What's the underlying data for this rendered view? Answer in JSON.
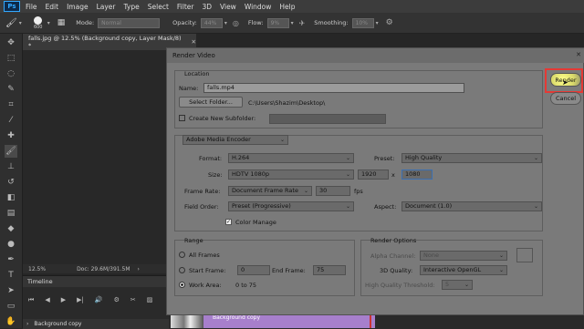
{
  "menubar": {
    "logo": "Ps",
    "items": [
      "File",
      "Edit",
      "Image",
      "Layer",
      "Type",
      "Select",
      "Filter",
      "3D",
      "View",
      "Window",
      "Help"
    ]
  },
  "options": {
    "brush_size": "600",
    "mode_label": "Mode:",
    "mode_value": "Normal",
    "opacity_label": "Opacity:",
    "opacity_value": "44%",
    "flow_label": "Flow:",
    "flow_value": "9%",
    "smoothing_label": "Smoothing:",
    "smoothing_value": "10%"
  },
  "document": {
    "tab_title": "falls.jpg @ 12.5% (Background copy, Layer Mask/8) *",
    "zoom": "12.5%",
    "doc_size": "Doc: 29.6M/391.5M",
    "timeline_label": "Timeline",
    "layer_name": "Background copy",
    "clip_name": "Background copy"
  },
  "dialog": {
    "title": "Render Video",
    "location": {
      "section_label": "Location",
      "name_label": "Name:",
      "name_value": "falls.mp4",
      "select_folder_label": "Select Folder...",
      "folder_path": "C:\\Users\\Shazim\\Desktop\\",
      "subfolder_label": "Create New Subfolder:"
    },
    "encoder": {
      "selected": "Adobe Media Encoder",
      "format_label": "Format:",
      "format_value": "H.264",
      "preset_label": "Preset:",
      "preset_value": "High Quality",
      "size_label": "Size:",
      "size_value": "HDTV 1080p",
      "width_value": "1920",
      "x_label": "x",
      "height_value": "1080",
      "frame_rate_label": "Frame Rate:",
      "frame_rate_value": "Document Frame Rate",
      "fps_value": "30",
      "fps_label": "fps",
      "field_order_label": "Field Order:",
      "field_order_value": "Preset (Progressive)",
      "aspect_label": "Aspect:",
      "aspect_value": "Document (1.0)",
      "color_manage_label": "Color Manage"
    },
    "range": {
      "section_label": "Range",
      "all_frames_label": "All Frames",
      "start_frame_label": "Start Frame:",
      "start_frame_value": "0",
      "end_frame_label": "End Frame:",
      "end_frame_value": "75",
      "work_area_label": "Work Area:",
      "work_area_value": "0 to 75"
    },
    "render_options": {
      "section_label": "Render Options",
      "alpha_label": "Alpha Channel:",
      "alpha_value": "None",
      "quality_label": "3D Quality:",
      "quality_value": "Interactive OpenGL",
      "threshold_label": "High Quality Threshold:",
      "threshold_value": "5"
    },
    "render_button": "Render",
    "cancel_button": "Cancel"
  },
  "colors": {
    "highlight": "#e53935",
    "cursor_glow": "#ffff66"
  }
}
